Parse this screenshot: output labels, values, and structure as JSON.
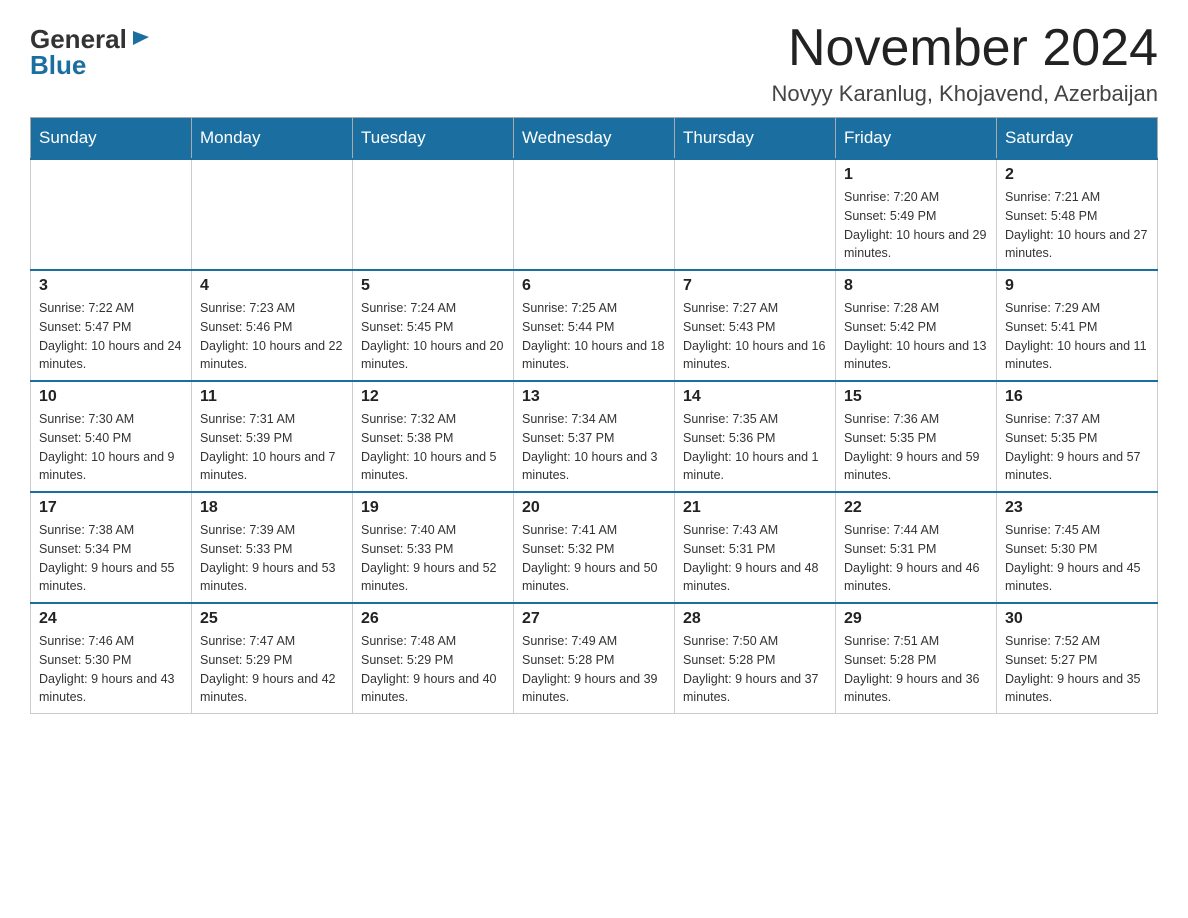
{
  "header": {
    "logo_general": "General",
    "logo_blue": "Blue",
    "month_title": "November 2024",
    "location": "Novyy Karanlug, Khojavend, Azerbaijan"
  },
  "weekdays": [
    "Sunday",
    "Monday",
    "Tuesday",
    "Wednesday",
    "Thursday",
    "Friday",
    "Saturday"
  ],
  "weeks": [
    [
      {
        "day": "",
        "info": ""
      },
      {
        "day": "",
        "info": ""
      },
      {
        "day": "",
        "info": ""
      },
      {
        "day": "",
        "info": ""
      },
      {
        "day": "",
        "info": ""
      },
      {
        "day": "1",
        "info": "Sunrise: 7:20 AM\nSunset: 5:49 PM\nDaylight: 10 hours and 29 minutes."
      },
      {
        "day": "2",
        "info": "Sunrise: 7:21 AM\nSunset: 5:48 PM\nDaylight: 10 hours and 27 minutes."
      }
    ],
    [
      {
        "day": "3",
        "info": "Sunrise: 7:22 AM\nSunset: 5:47 PM\nDaylight: 10 hours and 24 minutes."
      },
      {
        "day": "4",
        "info": "Sunrise: 7:23 AM\nSunset: 5:46 PM\nDaylight: 10 hours and 22 minutes."
      },
      {
        "day": "5",
        "info": "Sunrise: 7:24 AM\nSunset: 5:45 PM\nDaylight: 10 hours and 20 minutes."
      },
      {
        "day": "6",
        "info": "Sunrise: 7:25 AM\nSunset: 5:44 PM\nDaylight: 10 hours and 18 minutes."
      },
      {
        "day": "7",
        "info": "Sunrise: 7:27 AM\nSunset: 5:43 PM\nDaylight: 10 hours and 16 minutes."
      },
      {
        "day": "8",
        "info": "Sunrise: 7:28 AM\nSunset: 5:42 PM\nDaylight: 10 hours and 13 minutes."
      },
      {
        "day": "9",
        "info": "Sunrise: 7:29 AM\nSunset: 5:41 PM\nDaylight: 10 hours and 11 minutes."
      }
    ],
    [
      {
        "day": "10",
        "info": "Sunrise: 7:30 AM\nSunset: 5:40 PM\nDaylight: 10 hours and 9 minutes."
      },
      {
        "day": "11",
        "info": "Sunrise: 7:31 AM\nSunset: 5:39 PM\nDaylight: 10 hours and 7 minutes."
      },
      {
        "day": "12",
        "info": "Sunrise: 7:32 AM\nSunset: 5:38 PM\nDaylight: 10 hours and 5 minutes."
      },
      {
        "day": "13",
        "info": "Sunrise: 7:34 AM\nSunset: 5:37 PM\nDaylight: 10 hours and 3 minutes."
      },
      {
        "day": "14",
        "info": "Sunrise: 7:35 AM\nSunset: 5:36 PM\nDaylight: 10 hours and 1 minute."
      },
      {
        "day": "15",
        "info": "Sunrise: 7:36 AM\nSunset: 5:35 PM\nDaylight: 9 hours and 59 minutes."
      },
      {
        "day": "16",
        "info": "Sunrise: 7:37 AM\nSunset: 5:35 PM\nDaylight: 9 hours and 57 minutes."
      }
    ],
    [
      {
        "day": "17",
        "info": "Sunrise: 7:38 AM\nSunset: 5:34 PM\nDaylight: 9 hours and 55 minutes."
      },
      {
        "day": "18",
        "info": "Sunrise: 7:39 AM\nSunset: 5:33 PM\nDaylight: 9 hours and 53 minutes."
      },
      {
        "day": "19",
        "info": "Sunrise: 7:40 AM\nSunset: 5:33 PM\nDaylight: 9 hours and 52 minutes."
      },
      {
        "day": "20",
        "info": "Sunrise: 7:41 AM\nSunset: 5:32 PM\nDaylight: 9 hours and 50 minutes."
      },
      {
        "day": "21",
        "info": "Sunrise: 7:43 AM\nSunset: 5:31 PM\nDaylight: 9 hours and 48 minutes."
      },
      {
        "day": "22",
        "info": "Sunrise: 7:44 AM\nSunset: 5:31 PM\nDaylight: 9 hours and 46 minutes."
      },
      {
        "day": "23",
        "info": "Sunrise: 7:45 AM\nSunset: 5:30 PM\nDaylight: 9 hours and 45 minutes."
      }
    ],
    [
      {
        "day": "24",
        "info": "Sunrise: 7:46 AM\nSunset: 5:30 PM\nDaylight: 9 hours and 43 minutes."
      },
      {
        "day": "25",
        "info": "Sunrise: 7:47 AM\nSunset: 5:29 PM\nDaylight: 9 hours and 42 minutes."
      },
      {
        "day": "26",
        "info": "Sunrise: 7:48 AM\nSunset: 5:29 PM\nDaylight: 9 hours and 40 minutes."
      },
      {
        "day": "27",
        "info": "Sunrise: 7:49 AM\nSunset: 5:28 PM\nDaylight: 9 hours and 39 minutes."
      },
      {
        "day": "28",
        "info": "Sunrise: 7:50 AM\nSunset: 5:28 PM\nDaylight: 9 hours and 37 minutes."
      },
      {
        "day": "29",
        "info": "Sunrise: 7:51 AM\nSunset: 5:28 PM\nDaylight: 9 hours and 36 minutes."
      },
      {
        "day": "30",
        "info": "Sunrise: 7:52 AM\nSunset: 5:27 PM\nDaylight: 9 hours and 35 minutes."
      }
    ]
  ]
}
